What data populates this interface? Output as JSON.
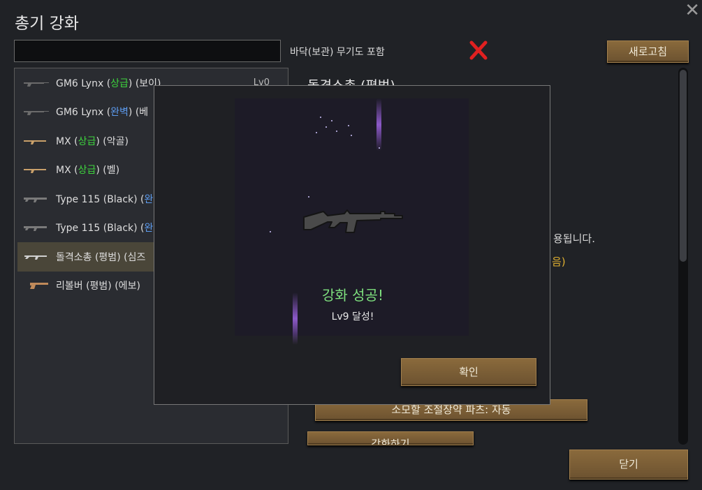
{
  "window": {
    "title": "총기 강화",
    "include_floor_label": "바닥(보관) 무기도 포함",
    "refresh_label": "새로고침",
    "close_label": "닫기"
  },
  "search": {
    "value": "",
    "placeholder": ""
  },
  "weapons": [
    {
      "name": "GM6 Lynx (",
      "quality": "상급",
      "tail": ") (보이)",
      "level": "Lv0",
      "quality_color": "green"
    },
    {
      "name": "GM6 Lynx (",
      "quality": "완벽",
      "tail": ") (베",
      "level": "",
      "quality_color": "blue"
    },
    {
      "name": "MX (",
      "quality": "상급",
      "tail": ") (악골)",
      "level": "",
      "quality_color": "green"
    },
    {
      "name": "MX (",
      "quality": "상급",
      "tail": ") (벨)",
      "level": "",
      "quality_color": "green"
    },
    {
      "name": "Type 115 (Black) (",
      "quality": "완",
      "tail": "",
      "level": "",
      "quality_color": "blue"
    },
    {
      "name": "Type 115 (Black) (",
      "quality": "완",
      "tail": "",
      "level": "",
      "quality_color": "blue"
    },
    {
      "name": "돌격소총 (평범) (심즈",
      "quality": "",
      "tail": "",
      "level": "",
      "quality_color": "none"
    },
    {
      "name": "리볼버 (평범) (에보)",
      "quality": "",
      "tail": "",
      "level": "",
      "quality_color": "none"
    }
  ],
  "detail": {
    "title": "돌격소총 (평범)",
    "note_applied": "용됩니다.",
    "note_yellow": "음)",
    "auto_parts_label": "소모할 조절장약 파츠: 자동",
    "enhance_label": "강화하기"
  },
  "modal": {
    "success": "강화 성공!",
    "level_reached": "Lv9 달성!",
    "confirm_label": "확인"
  },
  "colors": {
    "accent_button": "#7a5c34",
    "success_green": "#7ee07e",
    "quality_green": "#3dd43d",
    "quality_blue": "#5d9cf0",
    "close_red": "#e02020"
  }
}
